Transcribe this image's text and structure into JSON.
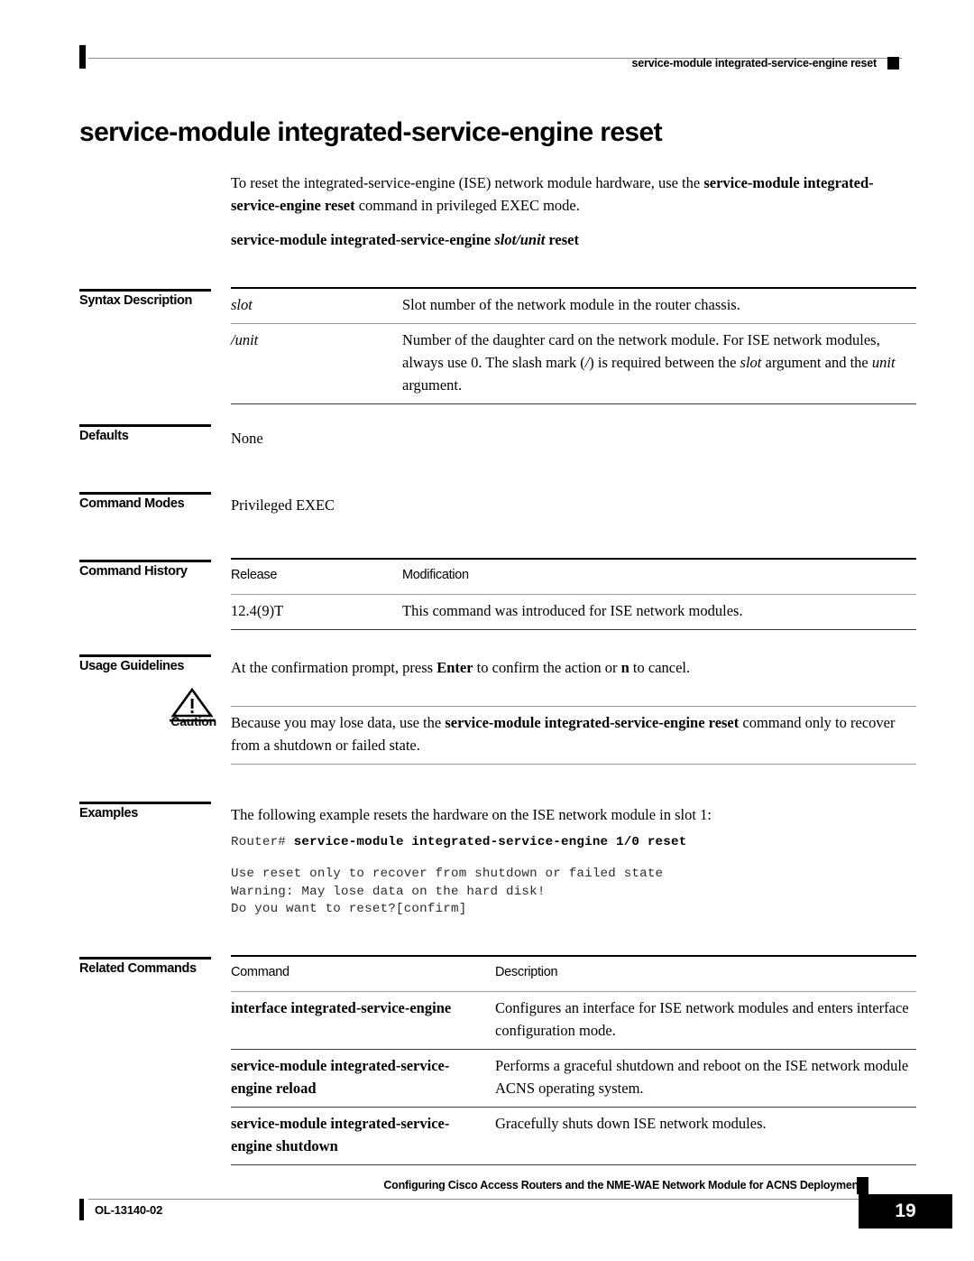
{
  "header": {
    "title": "service-module integrated-service-engine reset"
  },
  "page_title": "service-module integrated-service-engine reset",
  "intro": {
    "line1_pre": "To reset the integrated-service-engine (ISE) network module hardware, use the ",
    "line1_bold": "service-module integrated-service-engine reset",
    "line1_post": " command in privileged EXEC mode."
  },
  "syntax_line": {
    "bold1": "service-module integrated-service-engine ",
    "italic": "slot/unit",
    "bold2": " reset"
  },
  "sections": {
    "syntax_description": "Syntax Description",
    "defaults": "Defaults",
    "command_modes": "Command Modes",
    "command_history": "Command History",
    "usage_guidelines": "Usage Guidelines",
    "caution": "Caution",
    "examples": "Examples",
    "related_commands": "Related Commands"
  },
  "syntax_description": {
    "rows": [
      {
        "term": "slot",
        "desc": "Slot number of the network module in the router chassis."
      },
      {
        "term": "/unit",
        "desc_part1": "Number of the daughter card on the network module. For ISE network modules, always use 0. The slash mark (",
        "desc_italic1": "/",
        "desc_part2": ") is required between the ",
        "desc_italic2": "slot",
        "desc_part3": " argument and the ",
        "desc_italic3": "unit",
        "desc_part4": " argument."
      }
    ]
  },
  "defaults": {
    "value": "None"
  },
  "command_modes": {
    "value": "Privileged EXEC"
  },
  "command_history": {
    "headers": {
      "release": "Release",
      "modification": "Modification"
    },
    "rows": [
      {
        "release": "12.4(9)T",
        "modification": "This command was introduced for ISE network modules."
      }
    ]
  },
  "usage_guidelines": {
    "pre": "At the confirmation prompt, press ",
    "bold1": "Enter",
    "mid": " to confirm the action or ",
    "bold2": "n",
    "post": " to cancel."
  },
  "caution": {
    "pre": "Because you may lose data, use the ",
    "bold": "service-module integrated-service-engine reset",
    "post": " command only to recover from a shutdown or failed state."
  },
  "examples": {
    "intro": "The following example resets the hardware on the ISE network module in slot 1:",
    "prompt": "Router# ",
    "command": "service-module integrated-service-engine 1/0 reset",
    "output": "Use reset only to recover from shutdown or failed state\nWarning: May lose data on the hard disk!\nDo you want to reset?[confirm]"
  },
  "related_commands": {
    "headers": {
      "command": "Command",
      "description": "Description"
    },
    "rows": [
      {
        "command": "interface integrated-service-engine",
        "description": "Configures an interface for ISE network modules and enters interface configuration mode."
      },
      {
        "command": "service-module integrated-service-engine reload",
        "description": "Performs a graceful shutdown and reboot on the ISE network module ACNS operating system."
      },
      {
        "command": "service-module integrated-service-engine shutdown",
        "description": "Gracefully shuts down ISE network modules."
      }
    ]
  },
  "footer": {
    "title": "Configuring Cisco Access Routers and the NME-WAE Network Module for ACNS Deployments",
    "doc_id": "OL-13140-02",
    "page_number": "19"
  }
}
